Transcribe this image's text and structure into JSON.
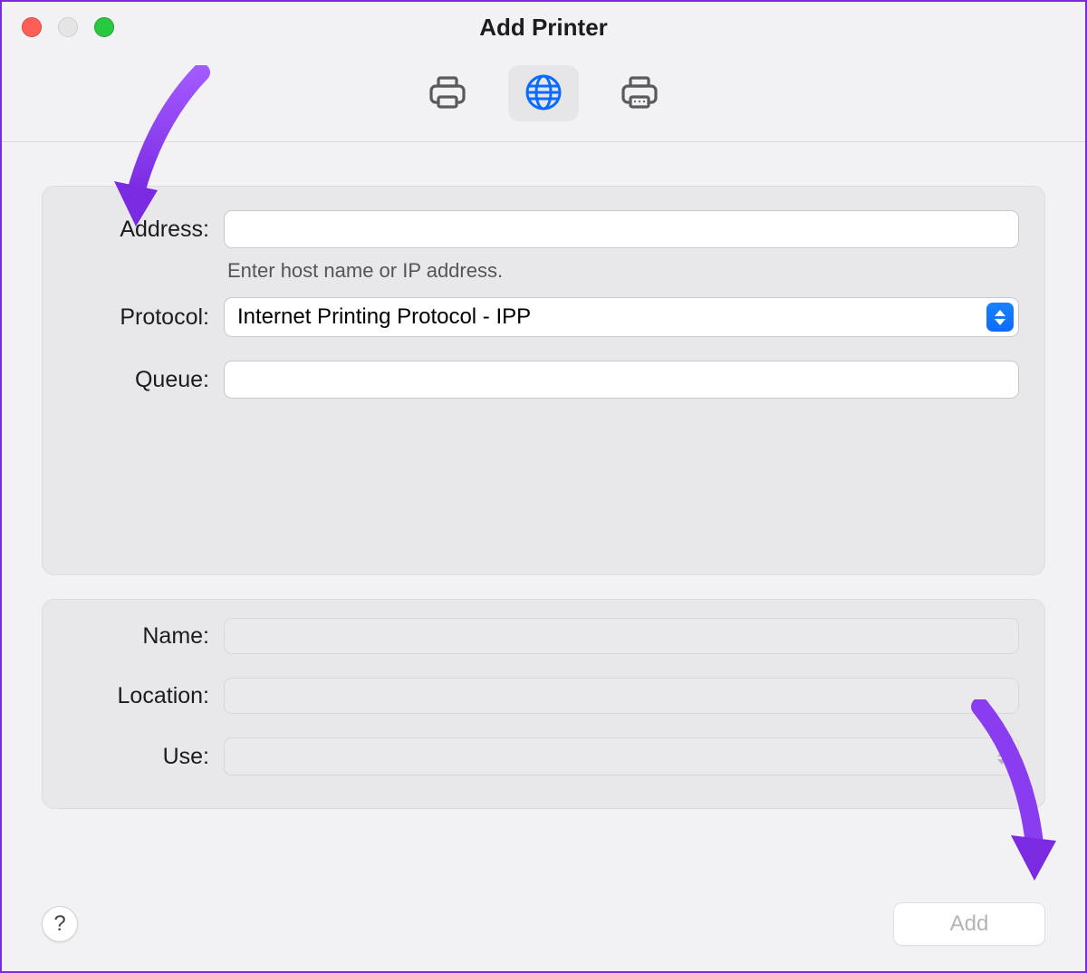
{
  "window": {
    "title": "Add Printer"
  },
  "tabs": {
    "default": {
      "name": "default-printer-tab",
      "selected": false
    },
    "ip": {
      "name": "ip-printer-tab",
      "selected": true
    },
    "windows": {
      "name": "windows-printer-tab",
      "selected": false
    }
  },
  "form": {
    "address": {
      "label": "Address:",
      "value": "",
      "hint": "Enter host name or IP address."
    },
    "protocol": {
      "label": "Protocol:",
      "value": "Internet Printing Protocol - IPP"
    },
    "queue": {
      "label": "Queue:",
      "value": ""
    }
  },
  "details": {
    "name": {
      "label": "Name:",
      "value": ""
    },
    "location": {
      "label": "Location:",
      "value": ""
    },
    "use": {
      "label": "Use:",
      "value": ""
    }
  },
  "footer": {
    "help_label": "?",
    "add_label": "Add",
    "add_enabled": false
  },
  "annotations": {
    "arrow_to_address": true,
    "arrow_to_add": true,
    "color": "#8a2be2"
  }
}
